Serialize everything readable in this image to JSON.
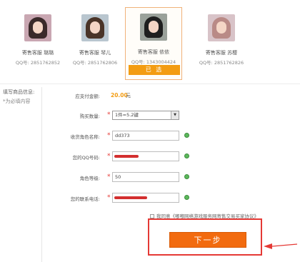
{
  "agents": [
    {
      "name": "寄售客服 璐璐",
      "qq": "QQ号: 2851762852",
      "colors": {
        "bg": "#c9a7b2",
        "hair": "#3a2a2a"
      }
    },
    {
      "name": "寄售客服 琴儿",
      "qq": "QQ号: 2851762806",
      "colors": {
        "bg": "#b9c6cf",
        "hair": "#4a3428"
      }
    },
    {
      "name": "寄售客服 依依",
      "qq": "QQ号: 1343004424",
      "selected": true,
      "button_label": "已 选",
      "colors": {
        "bg": "#9aa19a",
        "hair": "#1f1f1f"
      }
    },
    {
      "name": "寄售客服 苏樱",
      "qq": "QQ号: 2851762826",
      "colors": {
        "bg": "#d8c3c8",
        "hair": "#b98a86"
      }
    }
  ],
  "sidebar": {
    "title": "填写商品信息:",
    "note": "*为必填内容"
  },
  "form": {
    "amount_label": "应支付金额:",
    "amount_value": "20.00",
    "amount_unit": "元",
    "quantity_label": "购买数量:",
    "quantity_value": "1件=5.2键",
    "role_name_label": "收货角色名称:",
    "role_name_value": "dd373",
    "qq_label": "您的QQ号码:",
    "qq_value": "",
    "level_label": "角色等级:",
    "level_value": "50",
    "phone_label": "您的联系电话:",
    "phone_value": ""
  },
  "agreement": {
    "prefix": "我同意",
    "link": "《嘟嘟网络游戏服务网寄售交易买家协议》"
  },
  "next_label": "下一步",
  "colors": {
    "accent": "#f39c12",
    "button": "#f26b0f",
    "highlight": "#e53935",
    "ok": "#5cb85c",
    "required": "#e53935"
  }
}
